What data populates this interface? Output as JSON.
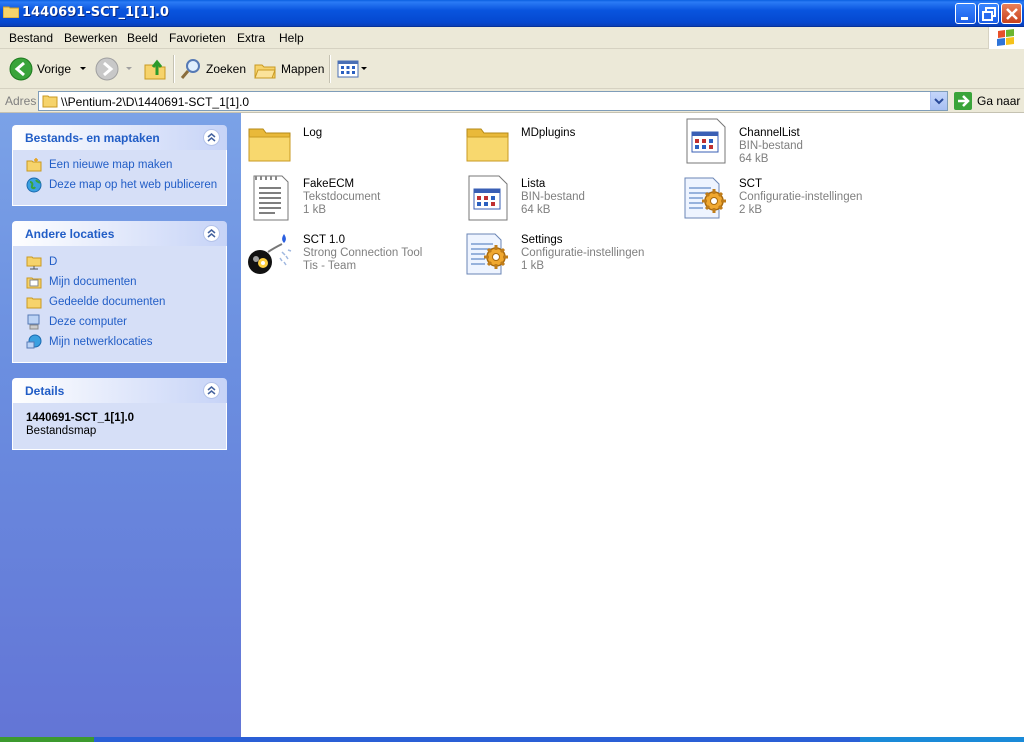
{
  "window": {
    "title": "1440691-SCT_1[1].0"
  },
  "menu": [
    "Bestand",
    "Bewerken",
    "Beeld",
    "Favorieten",
    "Extra",
    "Help"
  ],
  "toolbar": {
    "back": "Vorige",
    "search": "Zoeken",
    "folders": "Mappen"
  },
  "address": {
    "label": "Adres",
    "value": "\\\\Pentium-2\\D\\1440691-SCT_1[1].0",
    "go": "Ga naar"
  },
  "taskpane": {
    "tasks": {
      "title": "Bestands- en maptaken",
      "items": [
        "Een nieuwe map maken",
        "Deze map op het web publiceren"
      ]
    },
    "places": {
      "title": "Andere locaties",
      "items": [
        "D",
        "Mijn documenten",
        "Gedeelde documenten",
        "Deze computer",
        "Mijn netwerklocaties"
      ]
    },
    "details": {
      "title": "Details",
      "name": "1440691-SCT_1[1].0",
      "type": "Bestandsmap"
    }
  },
  "files": [
    {
      "name": "Log",
      "l2": "",
      "l3": "",
      "icon": "folder-icon"
    },
    {
      "name": "MDplugins",
      "l2": "",
      "l3": "",
      "icon": "folder-icon"
    },
    {
      "name": "ChannelList",
      "l2": "BIN-bestand",
      "l3": "64 kB",
      "icon": "bin-file-icon"
    },
    {
      "name": "FakeECM",
      "l2": "Tekstdocument",
      "l3": "1 kB",
      "icon": "text-file-icon"
    },
    {
      "name": "Lista",
      "l2": "BIN-bestand",
      "l3": "64 kB",
      "icon": "bin-file-icon"
    },
    {
      "name": "SCT",
      "l2": "Configuratie-instellingen",
      "l3": "2 kB",
      "icon": "config-file-icon"
    },
    {
      "name": "SCT 1.0",
      "l2": "Strong Connection Tool",
      "l3": "Tis - Team",
      "icon": "bomb-app-icon"
    },
    {
      "name": "Settings",
      "l2": "Configuratie-instellingen",
      "l3": "1 kB",
      "icon": "config-file-icon"
    }
  ]
}
